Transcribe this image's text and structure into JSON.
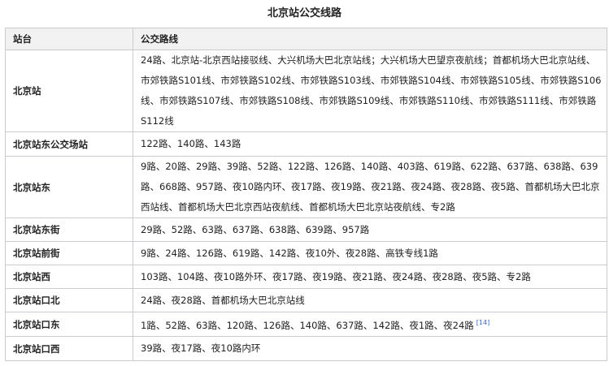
{
  "table": {
    "caption": "北京站公交线路",
    "headers": [
      "站台",
      "公交路线"
    ],
    "rows": [
      {
        "station": "北京站",
        "lines": "24路、北京站-北京西站接驳线、大兴机场大巴北京站线；大兴机场大巴望京夜航线；首都机场大巴北京站线、市郊铁路S101线、市郊铁路S102线、市郊铁路S103线、市郊铁路S104线、市郊铁路S105线、市郊铁路S106线、市郊铁路S107线、市郊铁路S108线、市郊铁路S109线、市郊铁路S110线、市郊铁路S111线、市郊铁路S112线",
        "ref": ""
      },
      {
        "station": "北京站东公交场站",
        "lines": "122路、140路、143路",
        "ref": ""
      },
      {
        "station": "北京站东",
        "lines": "9路、20路、29路、39路、52路、122路、126路、140路、403路、619路、622路、637路、638路、639路、668路、957路、夜10路内环、夜17路、夜19路、夜21路、夜24路、夜28路、夜5路、首都机场大巴北京西站线、首都机场大巴北京西站夜航线、首都机场大巴北京站夜航线、专2路",
        "ref": ""
      },
      {
        "station": "北京站东街",
        "lines": "29路、52路、63路、637路、638路、639路、957路",
        "ref": ""
      },
      {
        "station": "北京站前街",
        "lines": "9路、24路、126路、619路、142路、夜10外、夜28路、高铁专线1路",
        "ref": ""
      },
      {
        "station": "北京站西",
        "lines": "103路、104路、夜10路外环、夜17路、夜19路、夜21路、夜24路、夜28路、夜5路、专2路",
        "ref": ""
      },
      {
        "station": "北京站口北",
        "lines": "24路、夜28路、首都机场大巴北京站线",
        "ref": ""
      },
      {
        "station": "北京站口东",
        "lines": "1路、52路、63路、120路、126路、140路、637路、142路、夜1路、夜24路",
        "ref": "[14]"
      },
      {
        "station": "北京站口西",
        "lines": "39路、夜17路、夜10路内环",
        "ref": ""
      }
    ]
  }
}
